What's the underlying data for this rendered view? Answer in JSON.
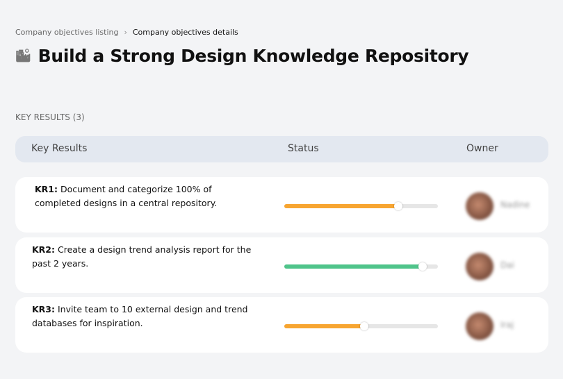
{
  "breadcrumb": {
    "parent": "Company objectives listing",
    "separator": "›",
    "current": "Company objectives details"
  },
  "title": {
    "icon": "building-chart-icon",
    "text": "Build a Strong Design Knowledge Repository"
  },
  "section_label": "KEY RESULTS (3)",
  "table": {
    "headers": {
      "key_results": "Key Results",
      "status": "Status",
      "owner": "Owner"
    },
    "rows": [
      {
        "id": "KR1:",
        "text": " Document and categorize 100% of completed designs in a central repository.",
        "progress": 0.74,
        "color": "#f7a531",
        "owner": "Nadine"
      },
      {
        "id": "KR2:",
        "text": " Create a design trend analysis report for the past 2 years.",
        "progress": 0.9,
        "color": "#4fc48a",
        "owner": "Dai"
      },
      {
        "id": "KR3:",
        "text": " Invite team to 10 external design and trend databases for inspiration.",
        "progress": 0.52,
        "color": "#f7a531",
        "owner": "Iraj"
      }
    ]
  }
}
